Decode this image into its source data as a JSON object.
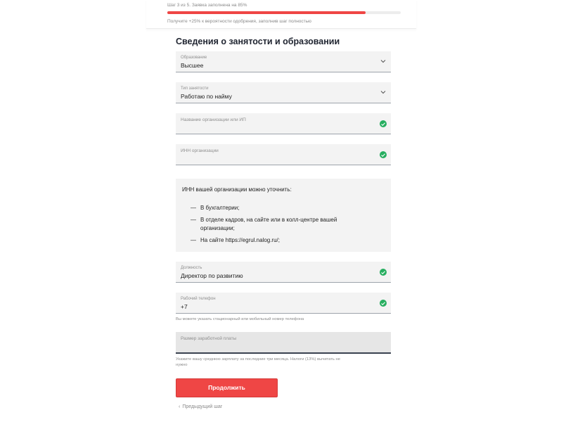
{
  "progress": {
    "caption": "Шаг 3 из 5. Заявка заполнена на 85%",
    "percent": 85,
    "hint": "Получите +25% к вероятности одобрения, заполнив шаг полностью"
  },
  "section": {
    "title": "Сведения о занятости и образовании"
  },
  "fields": {
    "education": {
      "label": "Образование",
      "value": "Высшее"
    },
    "employment": {
      "label": "Тип занятости",
      "value": "Работаю по найму"
    },
    "org_name": {
      "placeholder": "Название организации или ИП"
    },
    "org_inn": {
      "placeholder": "ИНН организации"
    },
    "position": {
      "label": "Должность",
      "value": "Директор по развитию"
    },
    "work_phone": {
      "label": "Рабочий телефон",
      "value": "+7",
      "helper": "Вы можете указать стационарный или мобильный номер телефона"
    },
    "salary": {
      "placeholder": "Размер заработной платы",
      "helper_line1": "Укажите вашу среднюю зарплату за последние три месяца. Налоги (13%) вычитать не",
      "helper_line2": "нужно"
    }
  },
  "info": {
    "title": "ИНН вашей организации можно уточнить:",
    "dash": "—",
    "items": [
      "В бухгалтерии;",
      "В отделе кадров, на сайте или в колл-центре вашей организации;",
      "На сайте https://egrul.nalog.ru/;"
    ]
  },
  "actions": {
    "continue": "Продолжить",
    "prev": "Предыдущий шаг",
    "prev_arrow": "‹"
  },
  "colors": {
    "accent": "#ef4645",
    "success": "#27ae60",
    "field_bg": "#f3f3f3"
  },
  "icons": {
    "dropdown": "chevron-down-icon",
    "valid": "check-circle-icon",
    "back": "chevron-left-icon"
  }
}
